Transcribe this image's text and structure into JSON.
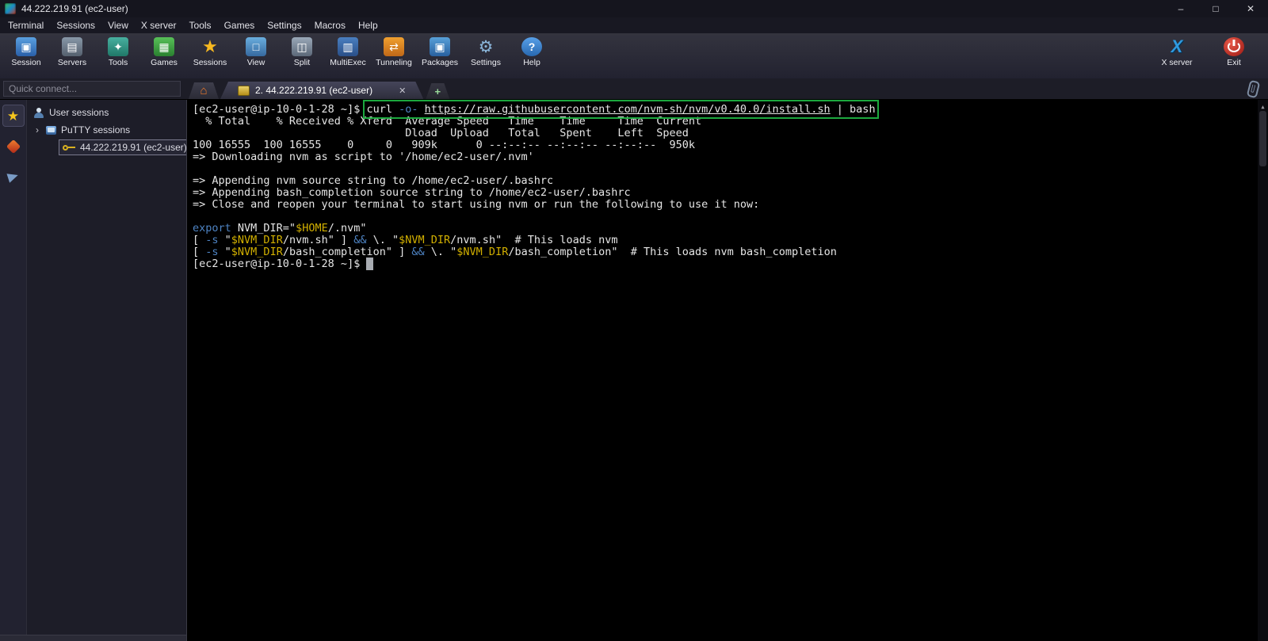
{
  "window": {
    "title": "44.222.219.91 (ec2-user)",
    "minimize_glyph": "–",
    "maximize_glyph": "□",
    "close_glyph": "✕"
  },
  "menu": {
    "items": [
      "Terminal",
      "Sessions",
      "View",
      "X server",
      "Tools",
      "Games",
      "Settings",
      "Macros",
      "Help"
    ]
  },
  "toolbar": {
    "items": [
      {
        "id": "session",
        "label": "Session",
        "glyph": "▣"
      },
      {
        "id": "servers",
        "label": "Servers",
        "glyph": "▤"
      },
      {
        "id": "tools",
        "label": "Tools",
        "glyph": "✦"
      },
      {
        "id": "games",
        "label": "Games",
        "glyph": "▦"
      },
      {
        "id": "sessions",
        "label": "Sessions",
        "glyph": "★"
      },
      {
        "id": "view",
        "label": "View",
        "glyph": "□"
      },
      {
        "id": "split",
        "label": "Split",
        "glyph": "◫"
      },
      {
        "id": "multiexec",
        "label": "MultiExec",
        "glyph": "▥"
      },
      {
        "id": "tunneling",
        "label": "Tunneling",
        "glyph": "⇄"
      },
      {
        "id": "packages",
        "label": "Packages",
        "glyph": "▣"
      },
      {
        "id": "settings",
        "label": "Settings",
        "glyph": "⚙"
      },
      {
        "id": "help",
        "label": "Help",
        "glyph": "?"
      }
    ],
    "right_items": [
      {
        "id": "xserver",
        "label": "X server",
        "glyph": "X"
      },
      {
        "id": "exit",
        "label": "Exit",
        "glyph": ""
      }
    ]
  },
  "tab_bar": {
    "quick_connect_placeholder": "Quick connect...",
    "active_tab_label": "2. 44.222.219.91 (ec2-user)"
  },
  "icons": {
    "home": "⌂",
    "star": "★",
    "expander": "›",
    "tab_close": "✕",
    "new_tab": "+",
    "scroll_up": "▲"
  },
  "sidebar": {
    "tree": [
      {
        "label": "User sessions"
      },
      {
        "label": "PuTTY sessions"
      },
      {
        "label": "44.222.219.91 (ec2-user)"
      }
    ]
  },
  "colors": {
    "hl": "#1ca83e",
    "blue": "#4e84c4",
    "yellow": "#d2b000",
    "fg": "#e6e6e6"
  },
  "terminal": {
    "lines": [
      {
        "segments": [
          {
            "t": "[ec2-user@ip-10-0-1-28 ~]$ ",
            "c": "fg"
          },
          {
            "t": "curl ",
            "c": "fg",
            "b": true
          },
          {
            "t": "-o-",
            "c": "blue",
            "b": true
          },
          {
            "t": " ",
            "c": "fg",
            "b": true
          },
          {
            "t": "https://raw.githubusercontent.com/nvm-sh/nvm/v0.40.0/install.sh",
            "c": "url",
            "b": true
          },
          {
            "t": " | bash",
            "c": "fg",
            "b": true
          }
        ]
      },
      {
        "segments": [
          {
            "t": "  % Total    % Received % Xferd  Average Speed   Time    Time     Time  Current",
            "c": "fg"
          }
        ]
      },
      {
        "segments": [
          {
            "t": "                                 Dload  Upload   Total   Spent    Left  Speed",
            "c": "fg"
          }
        ]
      },
      {
        "segments": [
          {
            "t": "100 16555  100 16555    0     0   909k      0 --:--:-- --:--:-- --:--:--  950k",
            "c": "fg"
          }
        ]
      },
      {
        "segments": [
          {
            "t": "=> Downloading nvm as script to '/home/ec2-user/.nvm'",
            "c": "fg"
          }
        ]
      },
      {
        "segments": []
      },
      {
        "segments": [
          {
            "t": "=> Appending nvm source string to /home/ec2-user/.bashrc",
            "c": "fg"
          }
        ]
      },
      {
        "segments": [
          {
            "t": "=> Appending bash_completion source string to /home/ec2-user/.bashrc",
            "c": "fg"
          }
        ]
      },
      {
        "segments": [
          {
            "t": "=> Close and reopen your terminal to start using nvm or run the following to use it now:",
            "c": "fg"
          }
        ]
      },
      {
        "segments": []
      },
      {
        "segments": [
          {
            "t": "export",
            "c": "blue"
          },
          {
            "t": " NVM_DIR=\"",
            "c": "fg"
          },
          {
            "t": "$HOME",
            "c": "yellow"
          },
          {
            "t": "/.nvm\"",
            "c": "fg"
          }
        ]
      },
      {
        "segments": [
          {
            "t": "[ ",
            "c": "fg"
          },
          {
            "t": "-s",
            "c": "blue"
          },
          {
            "t": " \"",
            "c": "fg"
          },
          {
            "t": "$NVM_DIR",
            "c": "yellow"
          },
          {
            "t": "/nvm.sh\" ] ",
            "c": "fg"
          },
          {
            "t": "&&",
            "c": "blue"
          },
          {
            "t": " \\. \"",
            "c": "fg"
          },
          {
            "t": "$NVM_DIR",
            "c": "yellow"
          },
          {
            "t": "/nvm.sh\"  # This loads nvm",
            "c": "fg"
          }
        ]
      },
      {
        "segments": [
          {
            "t": "[ ",
            "c": "fg"
          },
          {
            "t": "-s",
            "c": "blue"
          },
          {
            "t": " \"",
            "c": "fg"
          },
          {
            "t": "$NVM_DIR",
            "c": "yellow"
          },
          {
            "t": "/bash_completion\" ] ",
            "c": "fg"
          },
          {
            "t": "&&",
            "c": "blue"
          },
          {
            "t": " \\. \"",
            "c": "fg"
          },
          {
            "t": "$NVM_DIR",
            "c": "yellow"
          },
          {
            "t": "/bash_completion\"  # This loads nvm bash_completion",
            "c": "fg"
          }
        ]
      },
      {
        "segments": [
          {
            "t": "[ec2-user@ip-10-0-1-28 ~]$ ",
            "c": "fg"
          },
          {
            "t": " ",
            "c": "cursor"
          }
        ]
      }
    ]
  }
}
